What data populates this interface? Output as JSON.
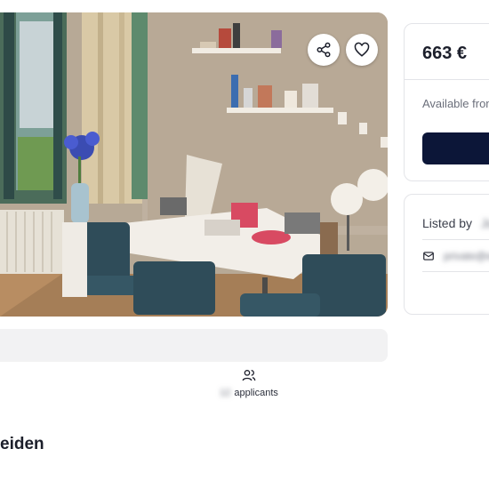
{
  "listing": {
    "price": "663 €",
    "available_label": "Available from",
    "listed_by_label": "Listed by",
    "lister_name": "Joanne",
    "contact_email": "private@email.com",
    "applicants_count": "12",
    "applicants_label": "applicants",
    "city_heading": "eiden"
  },
  "gallery": {
    "photo_count": 5,
    "active_index": 3
  },
  "icons": {
    "share": "share-icon",
    "favorite": "heart-icon",
    "applicants": "users-icon",
    "mail": "mail-icon"
  },
  "colors": {
    "primary_button": "#0c1638",
    "card_border": "#e3e4e8",
    "grey_bar": "#f2f2f3"
  }
}
